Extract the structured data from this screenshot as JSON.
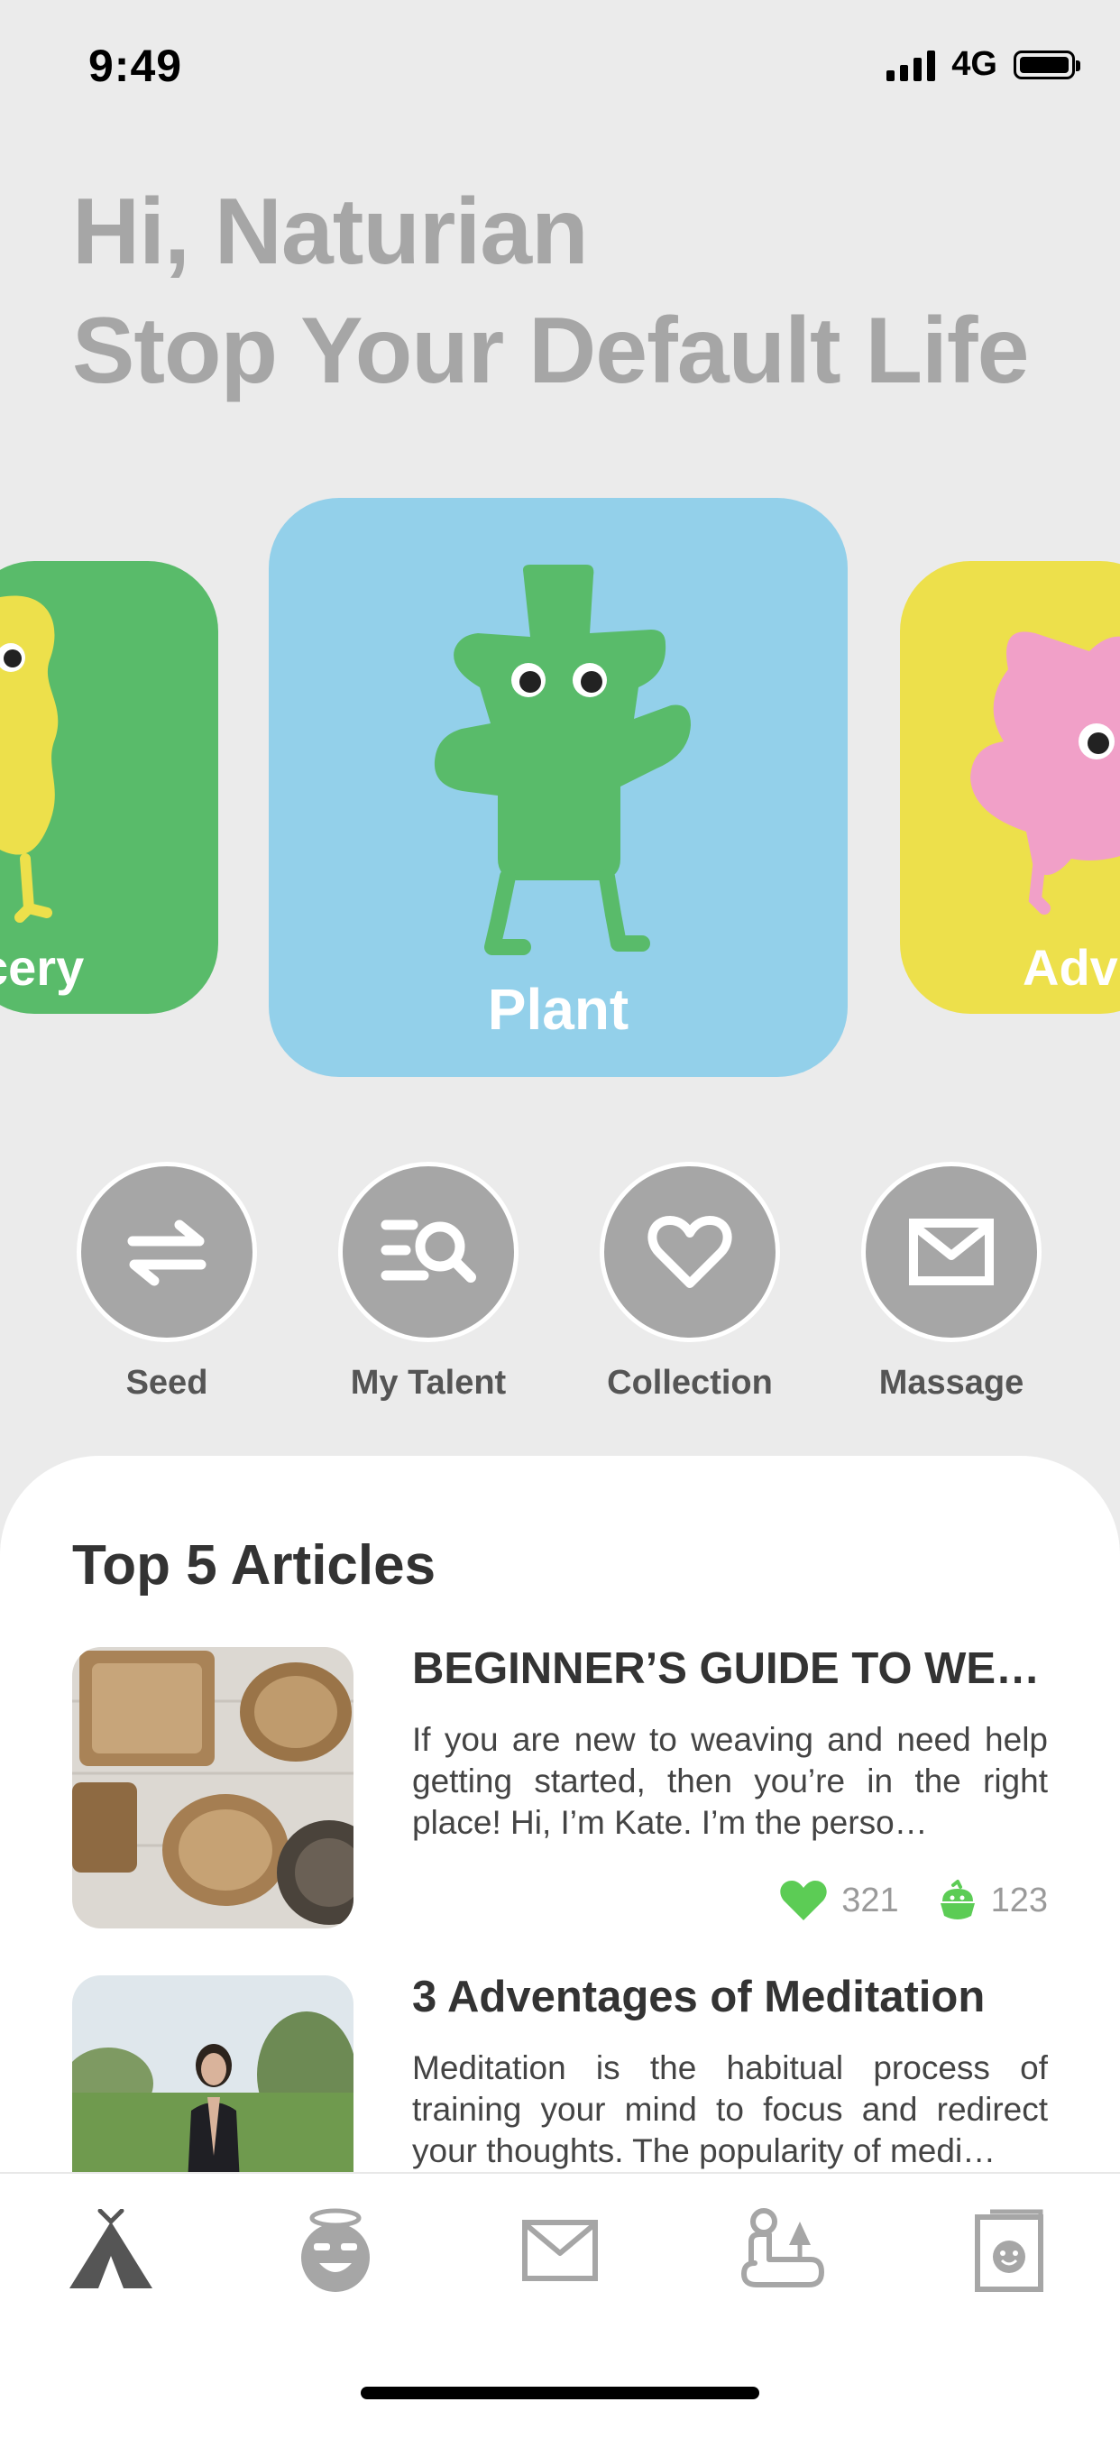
{
  "status": {
    "time": "9:49",
    "network": "4G"
  },
  "greeting": {
    "line1": "Hi, Naturian",
    "line2": "Stop Your Default Life"
  },
  "cards": [
    {
      "label": "cery",
      "color": "#59bb6a"
    },
    {
      "label": "Plant",
      "color": "#93d0ea"
    },
    {
      "label": "Adve",
      "color": "#ede04b"
    }
  ],
  "shortcuts": [
    {
      "label": "Seed",
      "icon": "swap-arrows-icon"
    },
    {
      "label": "My Talent",
      "icon": "list-search-icon"
    },
    {
      "label": "Collection",
      "icon": "heart-icon"
    },
    {
      "label": "Massage",
      "icon": "mail-icon"
    }
  ],
  "articles_section": {
    "title": "Top 5 Articles",
    "items": [
      {
        "title": "BEGINNER’S GUIDE TO WEA…",
        "body": "If you are new to weaving and need help getting started, then you’re in the right place!  Hi, I’m Kate. I’m the perso…",
        "likes": "321",
        "comments": "123"
      },
      {
        "title": "3 Adventages of Meditation",
        "body": "Meditation is the habitual process of training your mind to focus and redirect your thoughts.  The popularity of medi…"
      }
    ]
  },
  "tabbar": [
    "tent-icon",
    "angel-face-icon",
    "mail-icon",
    "person-plant-icon",
    "profile-card-icon"
  ],
  "colors": {
    "accent_green": "#59bb6a",
    "icon_gray": "#a6a6a6",
    "like_green": "#5ccc55"
  }
}
